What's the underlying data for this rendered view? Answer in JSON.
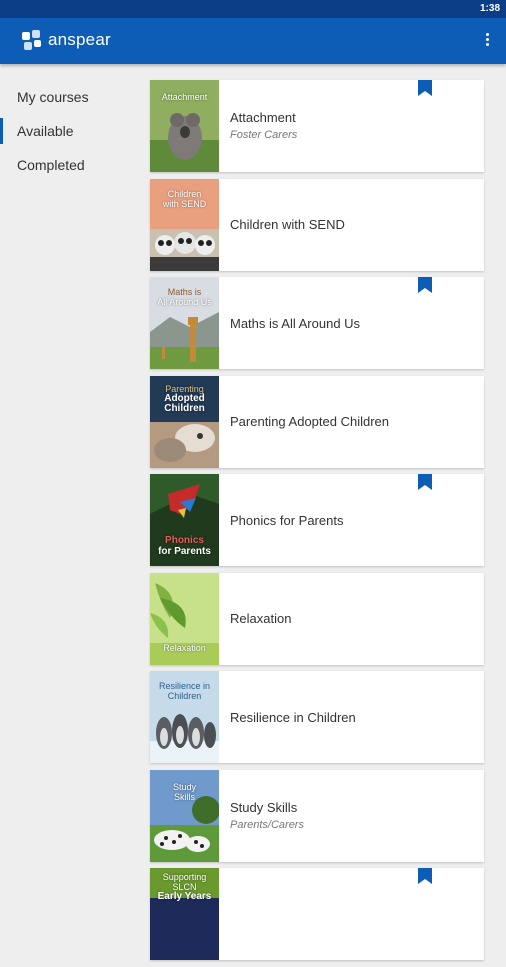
{
  "status_bar": {
    "time": "1:38"
  },
  "app_bar": {
    "brand": "anspear"
  },
  "sidebar": {
    "items": [
      {
        "label": "My courses"
      },
      {
        "label": "Available",
        "active": true
      },
      {
        "label": "Completed"
      }
    ]
  },
  "courses": [
    {
      "title": "Attachment",
      "subtitle": "Foster Carers",
      "bookmarked": true,
      "thumb_text": [
        "Attachment"
      ]
    },
    {
      "title": "Children with SEND",
      "subtitle": "",
      "bookmarked": false,
      "thumb_text": [
        "Children",
        "with SEND"
      ]
    },
    {
      "title": "Maths is All Around Us",
      "subtitle": "",
      "bookmarked": true,
      "thumb_text": [
        "Maths is",
        "All Around Us"
      ]
    },
    {
      "title": "Parenting Adopted Children",
      "subtitle": "",
      "bookmarked": false,
      "thumb_text": [
        "Parenting",
        "Adopted",
        "Children"
      ]
    },
    {
      "title": "Phonics for Parents",
      "subtitle": "",
      "bookmarked": true,
      "thumb_text": [
        "Phonics",
        "for Parents"
      ]
    },
    {
      "title": "Relaxation",
      "subtitle": "",
      "bookmarked": false,
      "thumb_text": [
        "Relaxation"
      ]
    },
    {
      "title": "Resilience in Children",
      "subtitle": "",
      "bookmarked": false,
      "thumb_text": [
        "Resilience in",
        "Children"
      ]
    },
    {
      "title": "Study Skills",
      "subtitle": "Parents/Carers",
      "bookmarked": false,
      "thumb_text": [
        "Study",
        "Skills"
      ]
    },
    {
      "title": "",
      "subtitle": "",
      "bookmarked": true,
      "thumb_text": [
        "Supporting",
        "SLCN",
        "Early Years"
      ]
    }
  ],
  "colors": {
    "primary": "#0d5cb6",
    "status_bar": "#0b3e86",
    "background": "#eeeeee"
  }
}
